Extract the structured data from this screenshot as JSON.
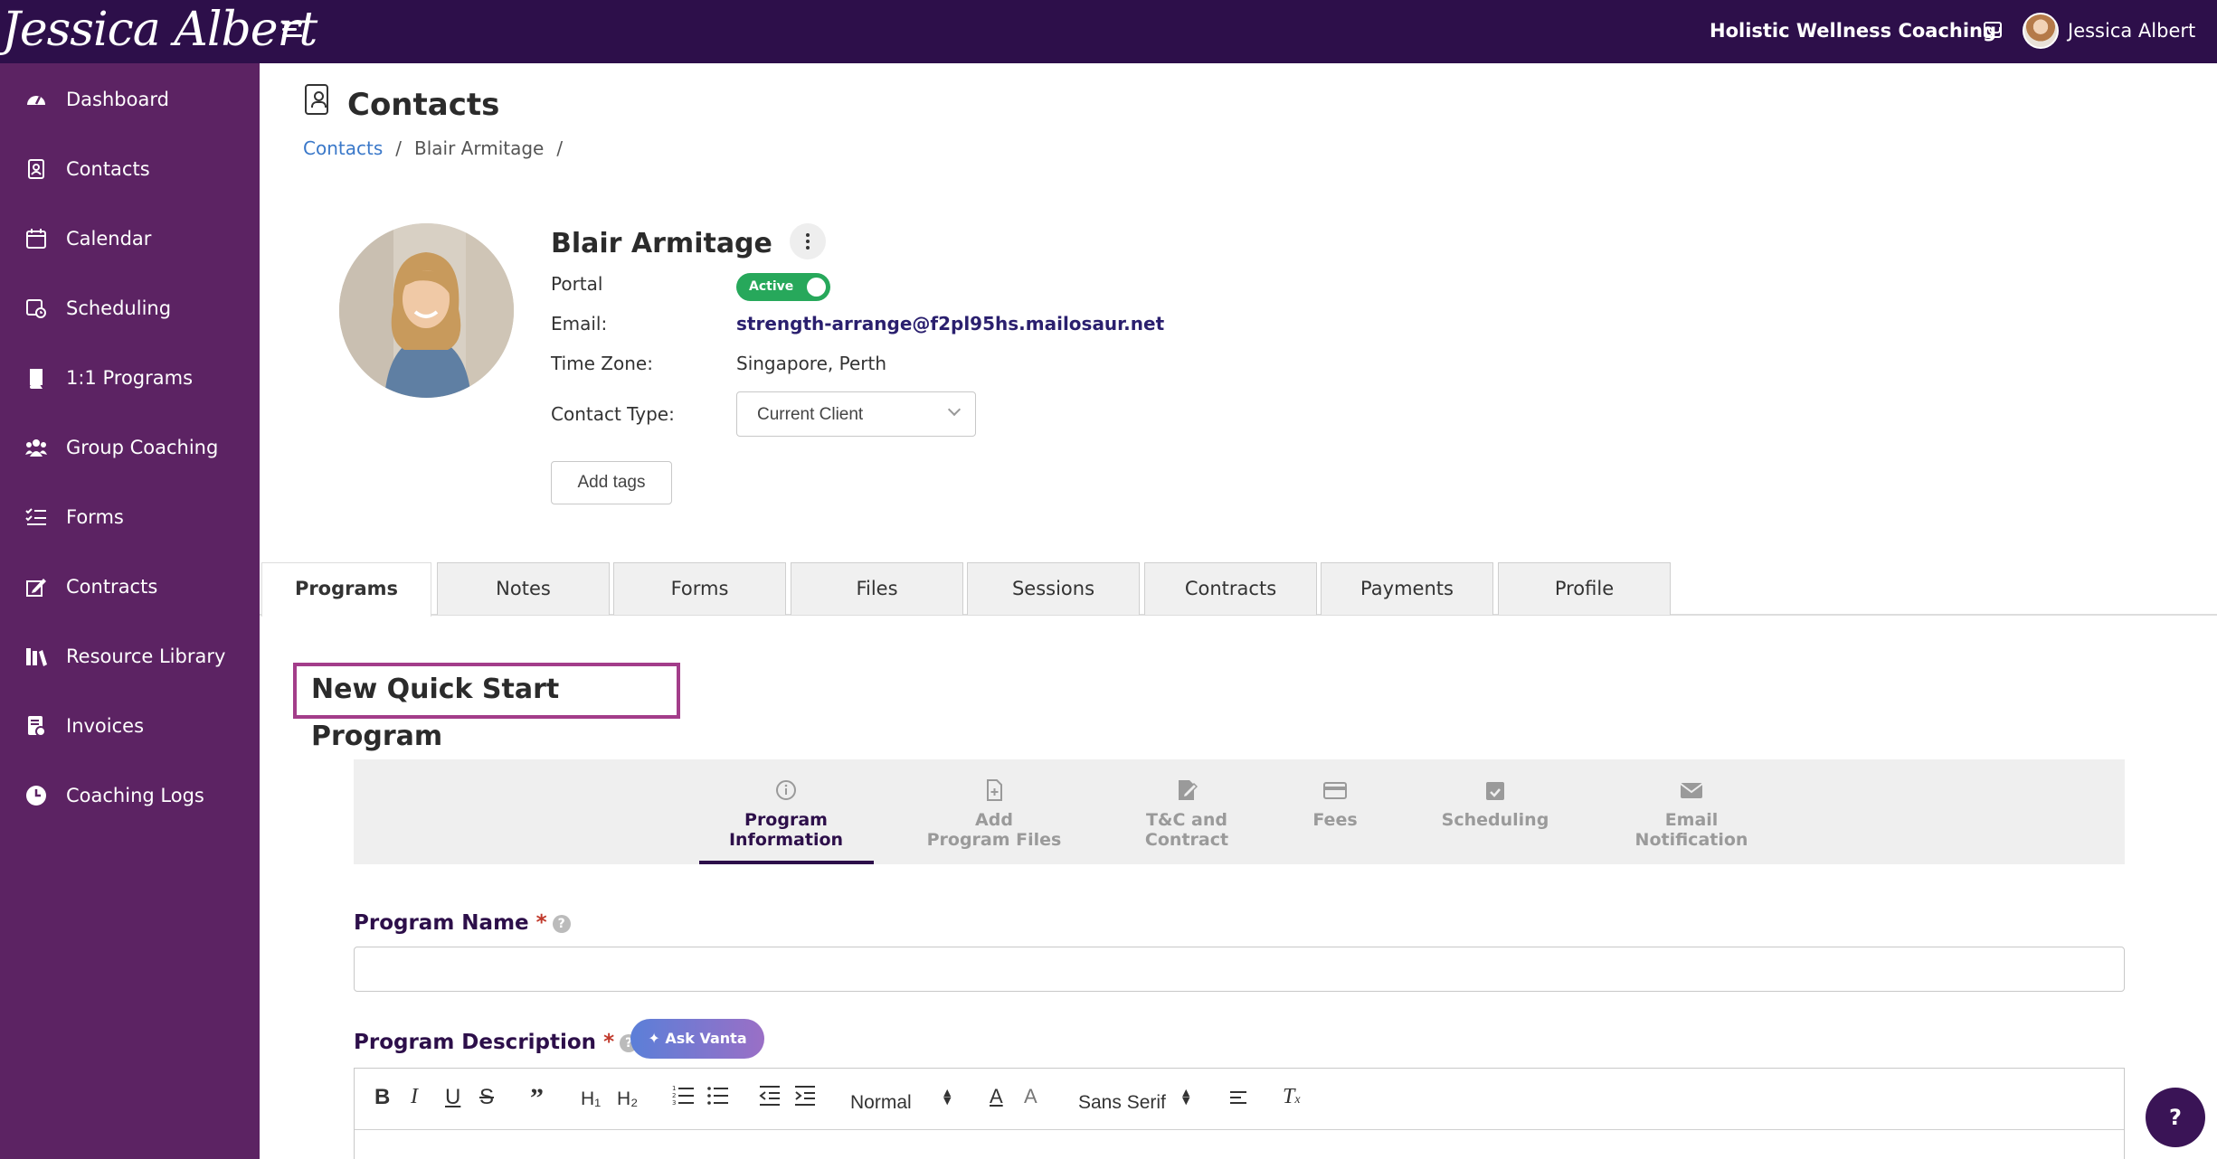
{
  "topbar": {
    "logo_text": "Jessica Albert",
    "business_name": "Holistic Wellness Coaching",
    "user_name": "Jessica Albert"
  },
  "sidebar": {
    "items": [
      {
        "label": "Dashboard",
        "icon": "dashboard-icon"
      },
      {
        "label": "Contacts",
        "icon": "contacts-icon"
      },
      {
        "label": "Calendar",
        "icon": "calendar-icon"
      },
      {
        "label": "Scheduling",
        "icon": "scheduling-icon"
      },
      {
        "label": "1:1 Programs",
        "icon": "book-icon"
      },
      {
        "label": "Group Coaching",
        "icon": "group-icon"
      },
      {
        "label": "Forms",
        "icon": "checklist-icon"
      },
      {
        "label": "Contracts",
        "icon": "signature-icon"
      },
      {
        "label": "Resource Library",
        "icon": "library-icon"
      },
      {
        "label": "Invoices",
        "icon": "invoice-icon"
      },
      {
        "label": "Coaching Logs",
        "icon": "clock-icon"
      }
    ]
  },
  "page": {
    "title": "Contacts",
    "breadcrumb": {
      "root": "Contacts",
      "current": "Blair Armitage",
      "separator": "/"
    }
  },
  "contact": {
    "name": "Blair Armitage",
    "portal_label": "Portal",
    "portal_status": "Active",
    "email_label": "Email:",
    "email": "strength-arrange@f2pl95hs.mailosaur.net",
    "timezone_label": "Time Zone:",
    "timezone": "Singapore, Perth",
    "contact_type_label": "Contact Type:",
    "contact_type": "Current Client",
    "add_tags_label": "Add tags"
  },
  "tabs": [
    "Programs",
    "Notes",
    "Forms",
    "Files",
    "Sessions",
    "Contracts",
    "Payments",
    "Profile"
  ],
  "active_tab": "Programs",
  "program": {
    "title": "New Quick Start Program",
    "steps": [
      {
        "line1": "Program",
        "line2": "Information",
        "icon": "info-icon"
      },
      {
        "line1": "Add",
        "line2": "Program Files",
        "icon": "file-add-icon"
      },
      {
        "line1": "T&C and",
        "line2": "Contract",
        "icon": "contract-icon"
      },
      {
        "line1": "Fees",
        "line2": "",
        "icon": "credit-card-icon"
      },
      {
        "line1": "Scheduling",
        "line2": "",
        "icon": "calendar-check-icon"
      },
      {
        "line1": "Email",
        "line2": "Notification",
        "icon": "envelope-icon"
      }
    ],
    "name_label": "Program Name",
    "name_value": "",
    "description_label": "Program Description",
    "required_mark": "*",
    "ask_button": "Ask Vanta",
    "editor_toolbar": {
      "heading_select": "Normal",
      "font_select": "Sans Serif"
    }
  },
  "help_button": "?",
  "colors": {
    "topbar": "#2d0f4a",
    "sidebar": "#5c2363",
    "active_toggle": "#27a85b",
    "program_title_border": "#a33d8a",
    "link": "#3a78c9"
  }
}
